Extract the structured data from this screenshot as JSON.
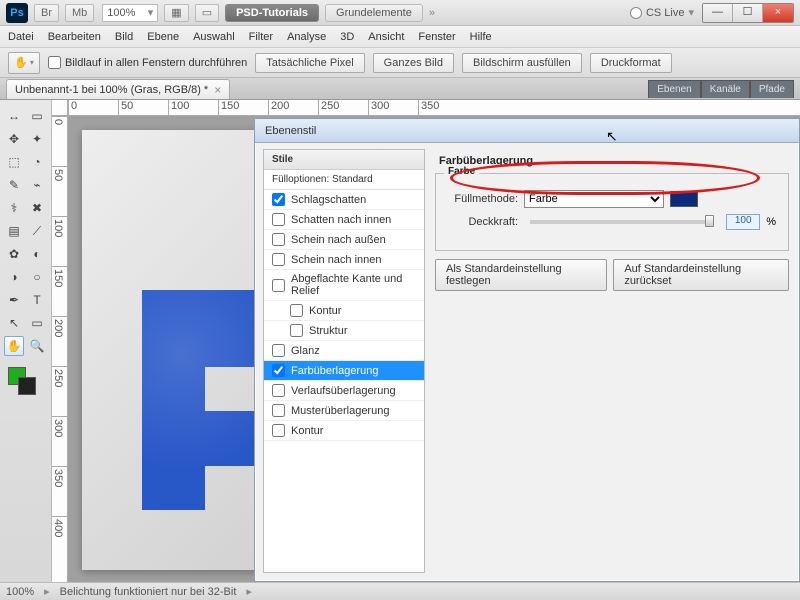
{
  "titlebar": {
    "tabs": {
      "br": "Br",
      "mb": "Mb"
    },
    "zoom_value": "100%",
    "arrange_icon": "▦",
    "screenmode_icon": "▭",
    "workspace_active": "PSD-Tutorials",
    "workspace_inactive": "Grundelemente",
    "cs_live": "CS Live"
  },
  "window_controls": {
    "min": "—",
    "max": "☐",
    "close": "×"
  },
  "menubar": [
    "Datei",
    "Bearbeiten",
    "Bild",
    "Ebene",
    "Auswahl",
    "Filter",
    "Analyse",
    "3D",
    "Ansicht",
    "Fenster",
    "Hilfe"
  ],
  "options_bar": {
    "scroll_all_label": "Bildlauf in allen Fenstern durchführen",
    "buttons": [
      "Tatsächliche Pixel",
      "Ganzes Bild",
      "Bildschirm ausfüllen",
      "Druckformat"
    ]
  },
  "document_tab": {
    "title": "Unbenannt-1 bei 100% (Gras, RGB/8) *",
    "close": "×"
  },
  "panel_tabs": [
    "Ebenen",
    "Kanäle",
    "Pfade"
  ],
  "ruler_h": [
    "0",
    "50",
    "100",
    "150",
    "200",
    "250",
    "300",
    "350"
  ],
  "ruler_v": [
    "0",
    "50",
    "100",
    "150",
    "200",
    "250",
    "300",
    "350",
    "400"
  ],
  "tools": {
    "glyphs": [
      "↔",
      "▭",
      "✥",
      "✦",
      "⬚",
      "◔",
      "✎",
      "⌁",
      "⚕",
      "✖",
      "▤",
      "⟋",
      "✿",
      "◐",
      "◑",
      "○",
      "✒",
      "T",
      "↖",
      "▭",
      "✋",
      "🔍"
    ]
  },
  "status": {
    "zoom": "100%",
    "msg": "Belichtung funktioniert nur bei 32-Bit"
  },
  "dialog": {
    "title": "Ebenenstil",
    "styles_header": "Stile",
    "fill_options": "Fülloptionen: Standard",
    "styles": [
      {
        "label": "Schlagschatten",
        "checked": true
      },
      {
        "label": "Schatten nach innen",
        "checked": false
      },
      {
        "label": "Schein nach außen",
        "checked": false
      },
      {
        "label": "Schein nach innen",
        "checked": false
      },
      {
        "label": "Abgeflachte Kante und Relief",
        "checked": false
      },
      {
        "label": "Kontur",
        "checked": false,
        "indent": true
      },
      {
        "label": "Struktur",
        "checked": false,
        "indent": true
      },
      {
        "label": "Glanz",
        "checked": false
      },
      {
        "label": "Farbüberlagerung",
        "checked": true,
        "selected": true
      },
      {
        "label": "Verlaufsüberlagerung",
        "checked": false
      },
      {
        "label": "Musterüberlagerung",
        "checked": false
      },
      {
        "label": "Kontur",
        "checked": false
      }
    ],
    "section_title": "Farbüberlagerung",
    "group_label": "Farbe",
    "blendmode_label": "Füllmethode:",
    "blendmode_value": "Farbe",
    "opacity_label": "Deckkraft:",
    "opacity_value": "100",
    "opacity_suffix": "%",
    "btn_default": "Als Standardeinstellung festlegen",
    "btn_reset": "Auf Standardeinstellung zurückset"
  },
  "colors": {
    "overlay": "#0b2a7a",
    "fg": "#1eae1e",
    "bg": "#111111"
  }
}
